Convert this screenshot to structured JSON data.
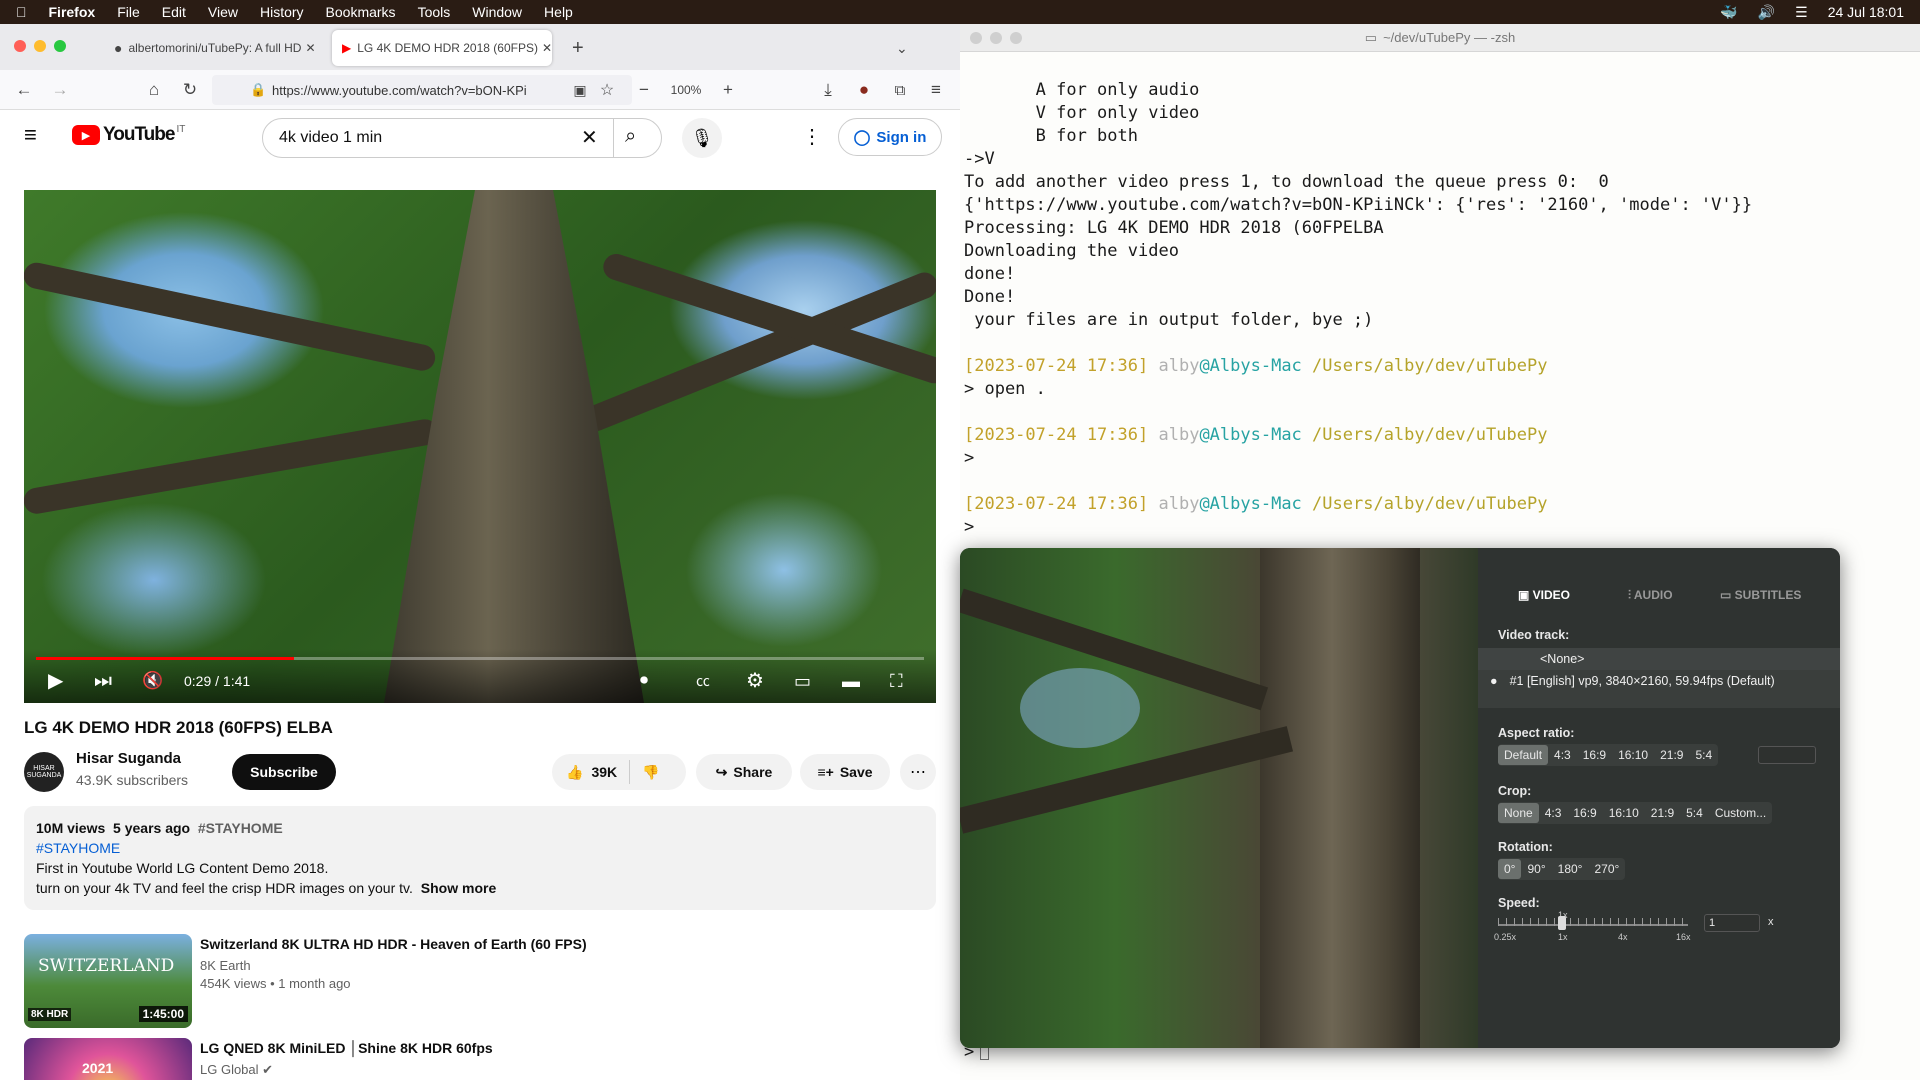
{
  "menubar": {
    "app": "Firefox",
    "items": [
      "File",
      "Edit",
      "View",
      "History",
      "Bookmarks",
      "Tools",
      "Window",
      "Help"
    ],
    "clock": "24 Jul  18:01"
  },
  "firefox": {
    "tabs": [
      {
        "label": "albertomorini/uTubePy: A full HD"
      },
      {
        "label": "LG 4K DEMO HDR 2018 (60FPS)"
      }
    ],
    "url": "https://www.youtube.com/watch?v=bON-KPi",
    "zoom": "100%"
  },
  "youtube": {
    "logo": "YouTube",
    "region": "IT",
    "search": "4k video 1 min",
    "signin": "Sign in",
    "player": {
      "time": "0:29 / 1:41",
      "progress": 0.29
    },
    "title": "LG 4K DEMO HDR 2018 (60FPS) ELBA",
    "channel": "Hisar Suganda",
    "subscribers": "43.9K subscribers",
    "subscribe": "Subscribe",
    "likes": "39K",
    "share": "Share",
    "save": "Save",
    "desc": {
      "views": "10M views",
      "ago": "5 years ago",
      "tag": "#STAYHOME",
      "tag2": "#STAYHOME",
      "line1": "First in Youtube World LG Content Demo 2018.",
      "line2": "turn on your 4k TV and feel the crisp HDR images on your tv.",
      "more": "Show more"
    },
    "related": [
      {
        "title": "Switzerland 8K ULTRA HD HDR - Heaven of Earth (60 FPS)",
        "channel": "8K Earth",
        "meta": "454K views • 1 month ago",
        "duration": "1:45:00",
        "thumbtext": "SWITZERLAND",
        "badge": "8K HDR"
      },
      {
        "title": "LG QNED 8K MiniLED │Shine 8K HDR 60fps",
        "channel": "LG Global ✔",
        "meta": "",
        "duration": "",
        "thumbtext": "2021",
        "badge": ""
      }
    ]
  },
  "terminal": {
    "title": "~/dev/uTubePy — -zsh",
    "lines": [
      "       A for only audio",
      "       V for only video",
      "       B for both",
      "->V",
      "To add another video press 1, to download the queue press 0:  0",
      "{'https://www.youtube.com/watch?v=bON-KPiiNCk': {'res': '2160', 'mode': 'V'}}",
      "Processing: LG 4K DEMO HDR 2018 (60FPELBA",
      "Downloading the video",
      "done!",
      "Done!",
      " your files are in output folder, bye ;)"
    ],
    "prompts": [
      {
        "ts": "[2023-07-24 17:36]",
        "user": "alby",
        "host": "@Albys-Mac",
        "path": "/Users/alby/dev/uTubePy",
        "cmd": "> open ."
      },
      {
        "ts": "[2023-07-24 17:36]",
        "user": "alby",
        "host": "@Albys-Mac",
        "path": "/Users/alby/dev/uTubePy",
        "cmd": ">"
      },
      {
        "ts": "[2023-07-24 17:36]",
        "user": "alby",
        "host": "@Albys-Mac",
        "path": "/Users/alby/dev/uTubePy",
        "cmd": ">"
      }
    ],
    "last_prompt": ">"
  },
  "vlc": {
    "tabs": [
      "VIDEO",
      "AUDIO",
      "SUBTITLES"
    ],
    "video_track_label": "Video track:",
    "track_none": "<None>",
    "track_1": "#1   [English] vp9, 3840×2160, 59.94fps (Default)",
    "aspect_label": "Aspect ratio:",
    "aspect": [
      "Default",
      "4:3",
      "16:9",
      "16:10",
      "21:9",
      "5:4"
    ],
    "crop_label": "Crop:",
    "crop": [
      "None",
      "4:3",
      "16:9",
      "16:10",
      "21:9",
      "5:4",
      "Custom..."
    ],
    "rotation_label": "Rotation:",
    "rotation": [
      "0°",
      "90°",
      "180°",
      "270°"
    ],
    "speed_label": "Speed:",
    "speed_ticks": [
      "0.25x",
      "1x",
      "4x",
      "16x"
    ],
    "speed_top": "1x",
    "speed_value": "1",
    "speed_unit": "x"
  }
}
